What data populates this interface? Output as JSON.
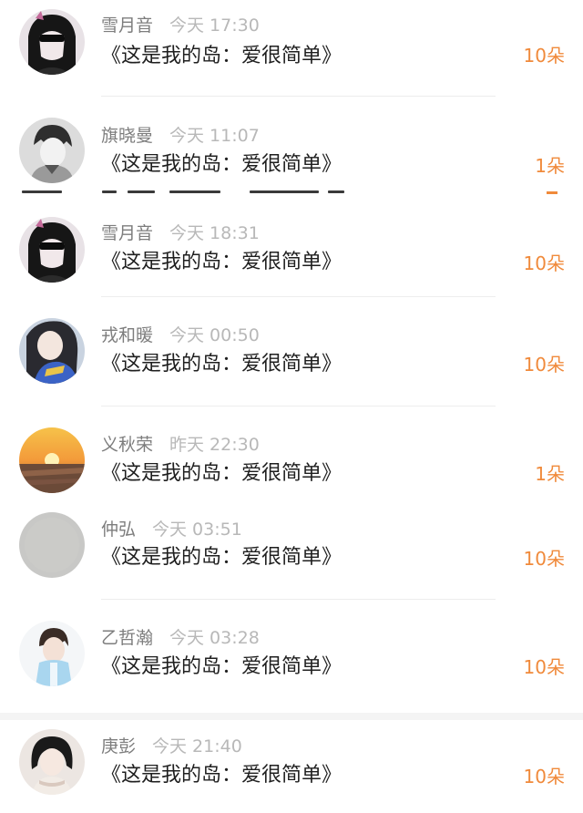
{
  "feed": {
    "items": [
      {
        "name": "雪月音",
        "time": "今天 17:30",
        "title": "《这是我的岛：爱很简单》",
        "count": "10朵",
        "avatar": "dark-hair-girl-avatar"
      },
      {
        "name": "旗晓曼",
        "time": "今天 11:07",
        "title": "《这是我的岛：爱很简单》",
        "count": "1朵",
        "avatar": "sketch-boy-avatar"
      },
      {
        "name": "雪月音",
        "time": "今天 18:31",
        "title": "《这是我的岛：爱很简单》",
        "count": "10朵",
        "avatar": "dark-hair-girl-avatar"
      },
      {
        "name": "戎和暖",
        "time": "今天 00:50",
        "title": "《这是我的岛：爱很简单》",
        "count": "10朵",
        "avatar": "blue-scarf-girl-avatar"
      },
      {
        "name": "义秋荣",
        "time": "昨天 22:30",
        "title": "《这是我的岛：爱很简单》",
        "count": "1朵",
        "avatar": "sunset-field-avatar"
      },
      {
        "name": "仲弘",
        "time": "今天 03:51",
        "title": "《这是我的岛：爱很简单》",
        "count": "10朵",
        "avatar": "grey-blank-avatar"
      },
      {
        "name": "乙哲瀚",
        "time": "今天 03:28",
        "title": "《这是我的岛：爱很简单》",
        "count": "10朵",
        "avatar": "light-blue-boy-avatar"
      },
      {
        "name": "庚彭",
        "time": "今天 21:40",
        "title": "《这是我的岛：爱很简单》",
        "count": "10朵",
        "avatar": "black-hair-girl-avatar"
      }
    ]
  },
  "colors": {
    "count": "#f08a3b",
    "name": "#7d7d7d",
    "time": "#b8b8b8",
    "title": "#1f1f1f"
  }
}
